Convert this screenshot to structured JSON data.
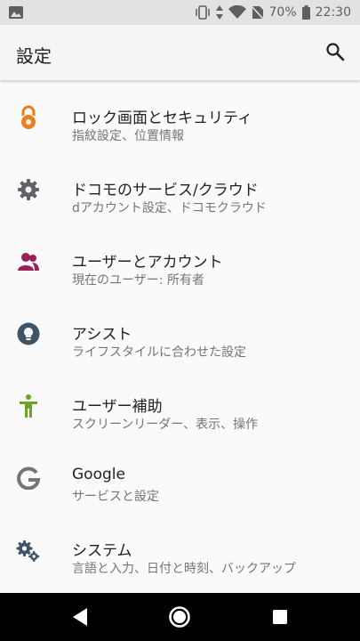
{
  "status_bar": {
    "battery_percent": "70%",
    "time": "22:30",
    "icons": [
      "image-icon",
      "vibrate-icon",
      "data-arrows-icon",
      "wifi-icon",
      "no-sim-icon",
      "battery-icon"
    ]
  },
  "app_bar": {
    "title": "設定",
    "search_icon": "search-icon"
  },
  "settings": [
    {
      "title": "ロック画面とセキュリティ",
      "subtitle": "指紋設定、位置情報",
      "icon": "lock-icon",
      "color": "#ef7f1a"
    },
    {
      "title": "ドコモのサービス/クラウド",
      "subtitle": "dアカウント設定、ドコモクラウド",
      "icon": "gear-icon",
      "color": "#5f6368"
    },
    {
      "title": "ユーザーとアカウント",
      "subtitle": "現在のユーザー: 所有者",
      "icon": "users-icon",
      "color": "#9c1f5a"
    },
    {
      "title": "アシスト",
      "subtitle": "ライフスタイルに合わせた設定",
      "icon": "lightbulb-icon",
      "color": "#3e5468"
    },
    {
      "title": "ユーザー補助",
      "subtitle": "スクリーンリーダー、表示、操作",
      "icon": "accessibility-icon",
      "color": "#6aa329"
    },
    {
      "title": "Google",
      "subtitle": "サービスと設定",
      "icon": "google-g-icon",
      "color": "#757575"
    },
    {
      "title": "システム",
      "subtitle": "言語と入力、日付と時刻、バックアップ",
      "icon": "gears-icon",
      "color": "#3e5468"
    }
  ],
  "nav_bar": {
    "buttons": [
      "back-icon",
      "home-icon",
      "recents-icon"
    ]
  }
}
